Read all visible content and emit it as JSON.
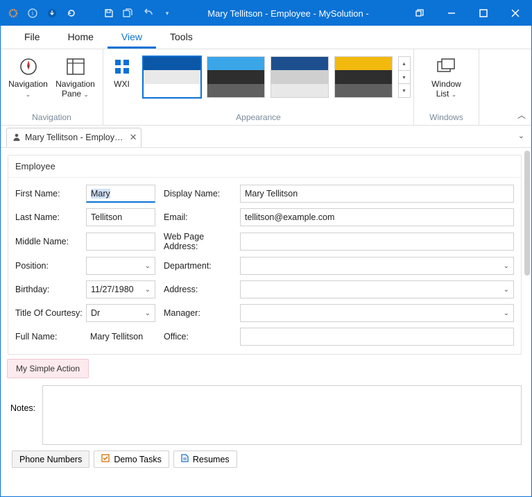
{
  "title": "Mary Tellitson - Employee - MySolution -",
  "menus": [
    "File",
    "Home",
    "View",
    "Tools"
  ],
  "active_menu_index": 2,
  "ribbon": {
    "nav_group": {
      "btn1": "Navigation",
      "btn2": "Navigation\nPane",
      "btn3": "WXI",
      "caption": "Navigation"
    },
    "appearance_caption": "Appearance",
    "windows_group": {
      "btn": "Window\nList",
      "caption": "Windows"
    }
  },
  "themes": [
    {
      "c1": "#0b57a8",
      "c2": "#e9e9e9",
      "c3": "#ffffff",
      "selected": true
    },
    {
      "c1": "#3aa6e8",
      "c2": "#2e2e2e",
      "c3": "#606060",
      "selected": false
    },
    {
      "c1": "#1d4f8f",
      "c2": "#cfcfcf",
      "c3": "#e8e8e8",
      "selected": false
    },
    {
      "c1": "#f2b90f",
      "c2": "#2e2e2e",
      "c3": "#606060",
      "selected": false
    }
  ],
  "doc_tab": "Mary Tellitson - Employ…",
  "form": {
    "header": "Employee",
    "left_labels": [
      "First Name:",
      "Last Name:",
      "Middle Name:",
      "Position:",
      "Birthday:",
      "Title Of Courtesy:",
      "Full Name:"
    ],
    "right_labels": [
      "Display Name:",
      "Email:",
      "Web Page Address:",
      "Department:",
      "Address:",
      "Manager:",
      "Office:"
    ],
    "values": {
      "first_name": "Mary",
      "last_name": "Tellitson",
      "middle_name": "",
      "position": "",
      "birthday": "11/27/1980",
      "title_of_courtesy": "Dr",
      "full_name": "Mary Tellitson",
      "display_name": "Mary Tellitson",
      "email": "tellitson@example.com",
      "web_page": "",
      "department": "",
      "address": "",
      "manager": "",
      "office": ""
    },
    "action_button": "My Simple Action",
    "notes_label": "Notes:"
  },
  "bottom_tabs": [
    "Phone Numbers",
    "Demo Tasks",
    "Resumes"
  ]
}
